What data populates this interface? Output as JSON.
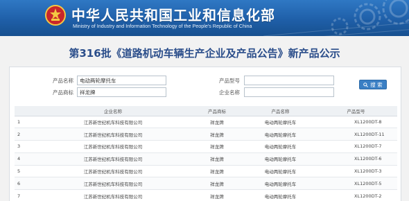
{
  "header": {
    "ministry_name": "中华人民共和国工业和信息化部",
    "ministry_name_en": "Ministry of Industry and Information Technology of the People's Republic of China"
  },
  "page": {
    "title": "第316批《道路机动车辆生产企业及产品公告》新产品公示"
  },
  "search": {
    "product_name_label": "产品名称",
    "product_name_value": "电动两轮摩托车",
    "product_model_label": "产品型号",
    "product_model_value": "",
    "brand_label": "产品商标",
    "brand_value": "祥龙牌",
    "company_label": "企业名称",
    "company_value": "",
    "button_label": "搜 索",
    "button_icon": "search-icon"
  },
  "table": {
    "columns": [
      "",
      "企业名称",
      "产品商标",
      "产品名称",
      "产品型号"
    ],
    "rows": [
      {
        "index": "1",
        "company": "江苏新世纪机车科技有限公司",
        "brand": "祥龙牌",
        "name": "电动两轮摩托车",
        "model": "XL1200DT-8"
      },
      {
        "index": "2",
        "company": "江苏新世纪机车科技有限公司",
        "brand": "祥龙牌",
        "name": "电动两轮摩托车",
        "model": "XL1200DT-11"
      },
      {
        "index": "3",
        "company": "江苏新世纪机车科技有限公司",
        "brand": "祥龙牌",
        "name": "电动两轮摩托车",
        "model": "XL1200DT-7"
      },
      {
        "index": "4",
        "company": "江苏新世纪机车科技有限公司",
        "brand": "祥龙牌",
        "name": "电动两轮摩托车",
        "model": "XL1200DT-6"
      },
      {
        "index": "5",
        "company": "江苏新世纪机车科技有限公司",
        "brand": "祥龙牌",
        "name": "电动两轮摩托车",
        "model": "XL1200DT-3"
      },
      {
        "index": "6",
        "company": "江苏新世纪机车科技有限公司",
        "brand": "祥龙牌",
        "name": "电动两轮摩托车",
        "model": "XL1200DT-5"
      },
      {
        "index": "7",
        "company": "江苏新世纪机车科技有限公司",
        "brand": "祥龙牌",
        "name": "电动两轮摩托车",
        "model": "XL1200DT-2"
      }
    ]
  },
  "colors": {
    "banner": "#1f5fa8",
    "title": "#2a4d8a",
    "button": "#3a7fc4"
  }
}
